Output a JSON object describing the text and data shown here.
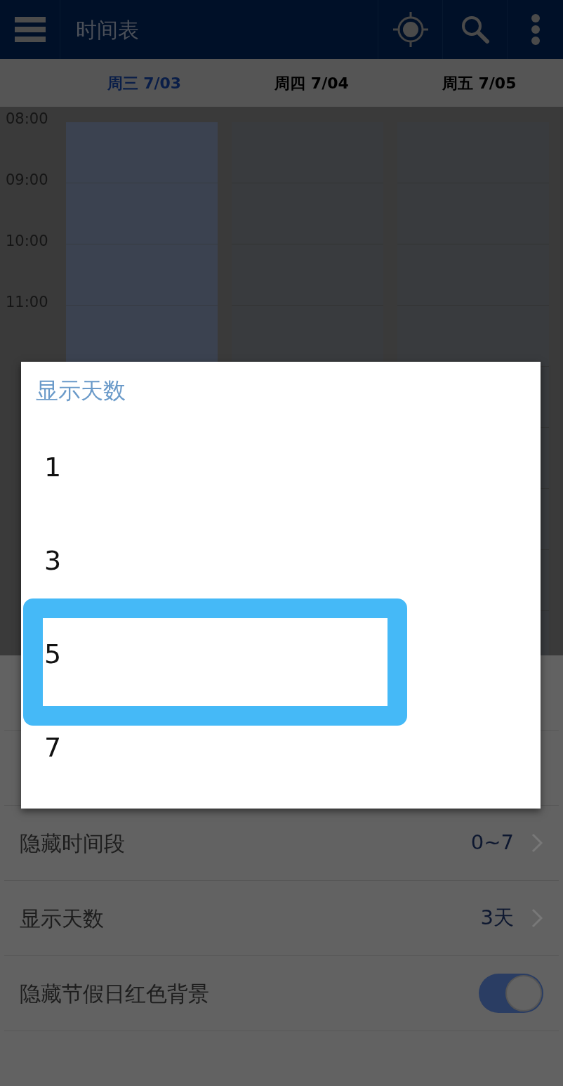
{
  "app_bar": {
    "title": "时间表"
  },
  "day_headers": [
    {
      "label": "周三 7/03",
      "selected": true
    },
    {
      "label": "周四 7/04",
      "selected": false
    },
    {
      "label": "周五 7/05",
      "selected": false
    }
  ],
  "time_labels": [
    "08:00",
    "09:00",
    "10:00",
    "11:00"
  ],
  "settings": [
    {
      "kind": "link",
      "label": "隐藏时间段",
      "value": "0~7"
    },
    {
      "kind": "link",
      "label": "显示天数",
      "value": "3天"
    },
    {
      "kind": "toggle",
      "label": "隐藏节假日红色背景",
      "on": true
    }
  ],
  "dialog": {
    "title": "显示天数",
    "options": [
      {
        "label": "1",
        "highlighted": false
      },
      {
        "label": "3",
        "highlighted": false
      },
      {
        "label": "5",
        "highlighted": true
      },
      {
        "label": "7",
        "highlighted": false
      }
    ]
  }
}
